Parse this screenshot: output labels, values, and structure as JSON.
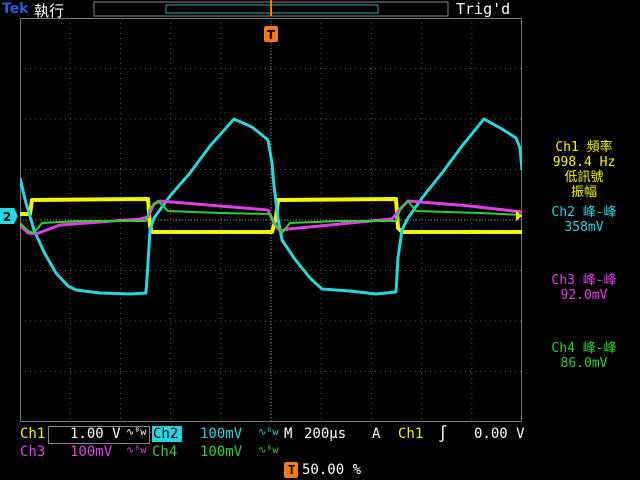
{
  "header": {
    "brand": "Tek",
    "run_status": "執行",
    "trigger_status": "Trig'd"
  },
  "colors": {
    "ch1": "#f5f500",
    "ch2": "#26d6e0",
    "ch3": "#e23ee8",
    "ch4": "#2fd12f",
    "trigger_marker": "#f07a16",
    "grid": "#5a5a5a"
  },
  "ch2_marker": "2",
  "trigger_marker": "T",
  "measurements": [
    {
      "channel": "Ch1",
      "name": "頻率",
      "value": "998.4 Hz",
      "note1": "低訊號",
      "note2": "振幅"
    },
    {
      "channel": "Ch2",
      "name": "峰-峰",
      "value": "358mV"
    },
    {
      "channel": "Ch3",
      "name": "峰-峰",
      "value": "92.0mV"
    },
    {
      "channel": "Ch4",
      "name": "峰-峰",
      "value": "86.0mV"
    }
  ],
  "bottom": {
    "ch1_label": "Ch1",
    "ch1_scale": "1.00 V",
    "ch2_label": "Ch2",
    "ch2_scale": "100mV",
    "ch3_label": "Ch3",
    "ch3_scale": "100mV",
    "ch4_label": "Ch4",
    "ch4_scale": "100mV",
    "timebase_label": "M",
    "timebase": "200µs",
    "trig_mode": "A",
    "trig_source": "Ch1",
    "trig_level": "0.00 V",
    "trig_pos": "50.00 %"
  }
}
